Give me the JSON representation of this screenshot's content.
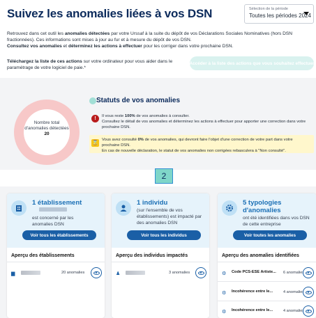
{
  "header": {
    "title": "Suivez les anomalies liées à vos DSN",
    "period_label": "Sélection de la période",
    "period_value": "Toutes les périodes 2024"
  },
  "intro": {
    "line1_pre": "Retrouvez dans cet outil les ",
    "line1_bold": "anomalies détectées",
    "line1_post": " par votre Urssaf à la suite du dépôt de vos Déclarations Sociales Nominatives (hors DSN fractionnées). Ces informations sont mises à jour au fur et à mesure du dépôt de vos DSN.",
    "line2_bold1": "Consultez vos anomalies",
    "line2_mid": " et ",
    "line2_bold2": "déterminez les actions à effectuer",
    "line2_post": " pour les corriger dans votre prochaine DSN."
  },
  "download": {
    "bold": "Téléchargez la liste de ces actions",
    "rest": " sur votre ordinateur pour vous aider dans le paramétrage de votre logiciel de paie.*"
  },
  "access_button": "Accéder à la liste des actions que vous souhaitez effectuer",
  "status": {
    "title": "Statuts de vos anomalies",
    "donut_label": "Nombre total d'anomalies détectées",
    "donut_count": "20",
    "red_pre": "Il vous reste ",
    "red_bold": "100%",
    "red_post": " de vos anomalies à consulter.",
    "red_line2": "Consultez le détail de vos anomalies et déterminez les actions à effectuer pour apporter une correction dans votre prochaine DSN.",
    "yellow_pre": "Vous avez consulté ",
    "yellow_bold": "0%",
    "yellow_post": " de vos anomalies, qui devront faire l'objet d'une correction de votre part dans votre prochaine DSN.",
    "yellow_line2": "En cas de nouvelle déclaration, le statut de vos anomalies non corrigées rebasculera à \"Non consulté\"."
  },
  "step": "2",
  "cards": {
    "etab": {
      "title": "1 établissement",
      "desc": "est concerné par les anomalies DSN",
      "button": "Voir tous les établissements",
      "section": "Aperçu des établissements",
      "rows": [
        {
          "count": "20 anomalies"
        }
      ]
    },
    "indiv": {
      "title": "1 individu",
      "desc": "(sur l'ensemble de vos établissements) est impacté par des anomalies DSN",
      "button": "Voir tous les individus",
      "section": "Aperçu des individus impactés",
      "rows": [
        {
          "count": "3 anomalies"
        }
      ]
    },
    "typo": {
      "title": "5 typologies d'anomalies",
      "desc": "ont été identifiées dans vos DSN de cette entreprise",
      "button": "Voir toutes les anomalies",
      "section": "Aperçu des anomalies identifiées",
      "rows": [
        {
          "label": "Code PCS-ESE Artiste...",
          "count": "6 anomalies"
        },
        {
          "label": "Incohérence entre le...",
          "count": "4 anomalies"
        },
        {
          "label": "Incohérence entre le...",
          "count": "4 anomalies"
        }
      ]
    }
  },
  "colors": {
    "title": "#0b2a5b",
    "accent": "#1a5fa6",
    "teal": "#7fd6c9",
    "donut": "#f7c8c8",
    "warning": "#fff7cc",
    "danger": "#b91c1c"
  }
}
